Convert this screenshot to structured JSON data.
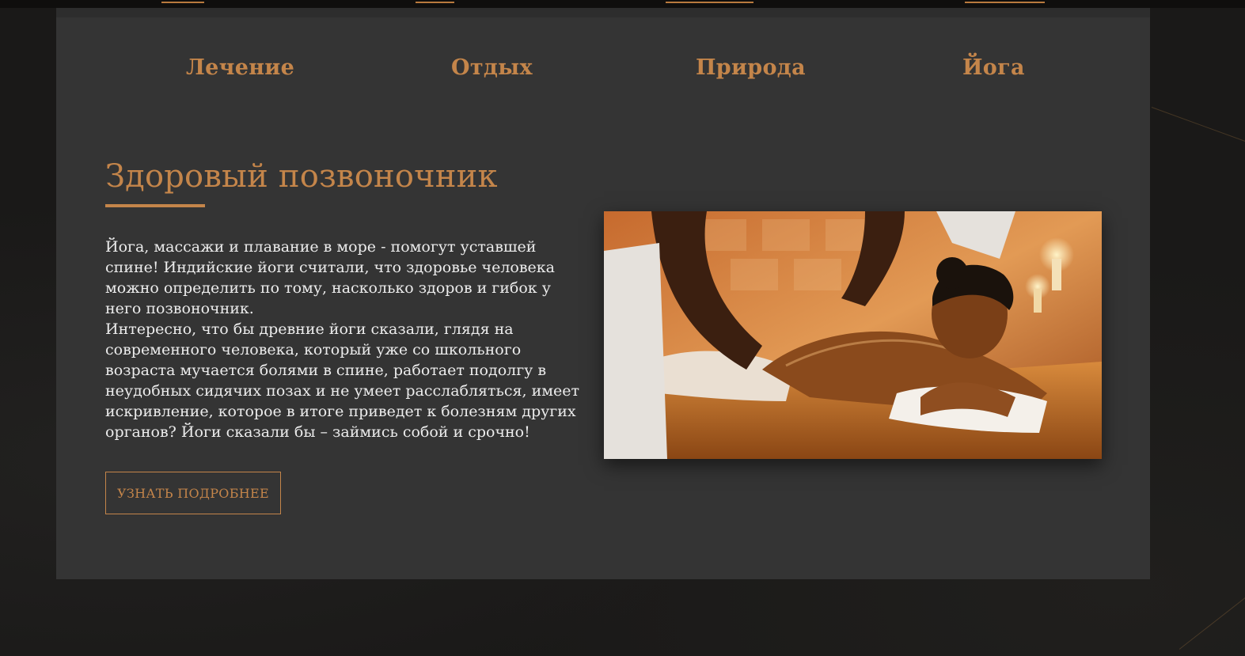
{
  "tabs": [
    {
      "label": "Лечение"
    },
    {
      "label": "Отдых"
    },
    {
      "label": "Природа"
    },
    {
      "label": "Йога"
    }
  ],
  "article": {
    "title": "Здоровый позвоночник",
    "paragraphs": [
      "Йога, массажи и плавание в море - помогут уставшей спине! Индийские йоги считали, что здоровье человека можно определить по тому, насколько здоров и гибок у него позвоночник.",
      "Интересно, что бы древние йоги сказали, глядя на современного человека, который уже со школьного возраста мучается болями в спине, работает подолгу в неудобных сидячих позах и не умеет расслабляться, имеет искривление, которое в итоге приведет к болезням других органов? Йоги сказали бы – займись собой и срочно!"
    ],
    "button_label": "УЗНАТЬ ПОДРОБНЕЕ"
  },
  "colors": {
    "accent": "#c4854a",
    "panel": "#343434",
    "page_background": "#1a1918",
    "text": "#ececec"
  }
}
